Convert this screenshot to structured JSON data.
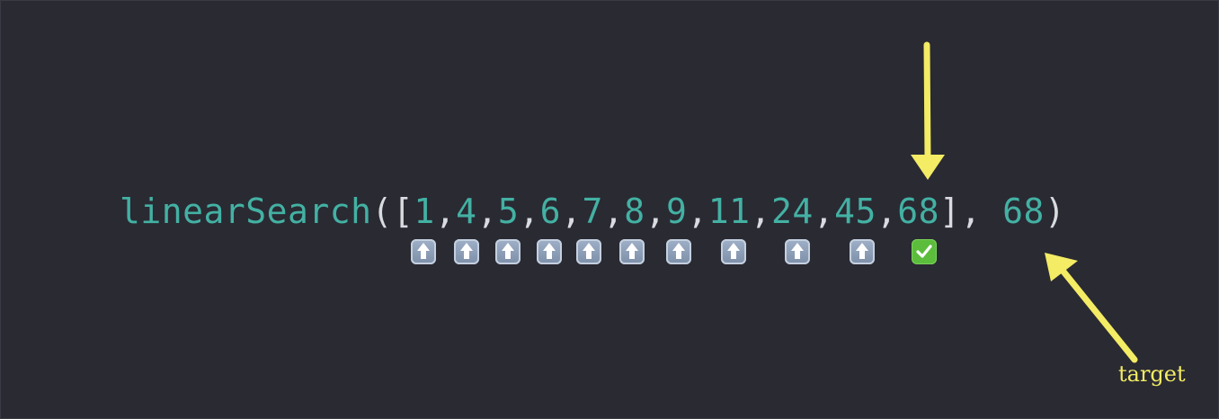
{
  "code": {
    "function_name": "linearSearch",
    "open_paren_bracket": "([",
    "comma": ",",
    "close_bracket_comma": "], ",
    "close_paren": ")",
    "array": [
      "1",
      "4",
      "5",
      "6",
      "7",
      "8",
      "9",
      "11",
      "24",
      "45",
      "68"
    ],
    "target": "68"
  },
  "markers": [
    "up-arrow",
    "up-arrow",
    "up-arrow",
    "up-arrow",
    "up-arrow",
    "up-arrow",
    "up-arrow",
    "up-arrow",
    "up-arrow",
    "up-arrow",
    "check-mark"
  ],
  "annotation": {
    "target_label": "target",
    "color": "#f3ec64"
  }
}
